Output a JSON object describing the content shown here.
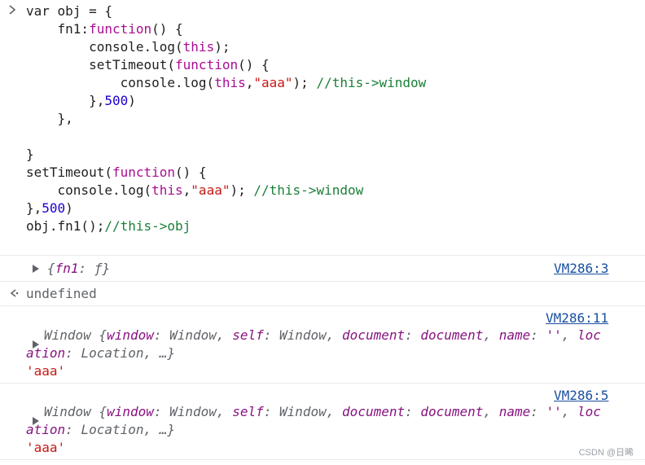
{
  "input": {
    "line_1": {
      "a": "var obj = {"
    },
    "line_2": {
      "a": "    fn1:",
      "b": "function",
      "c": "() {"
    },
    "line_3": {
      "a": "        console.log(",
      "b": "this",
      "c": ");"
    },
    "line_4": {
      "a": "        setTimeout(",
      "b": "function",
      "c": "() {"
    },
    "line_5": {
      "a": "            console.log(",
      "b": "this",
      "c": ",",
      "d": "\"aaa\"",
      "e": "); ",
      "f": "//this->window"
    },
    "line_6": {
      "a": "        },",
      "b": "500",
      "c": ")"
    },
    "line_7": {
      "a": "    },"
    },
    "line_8": {
      "a": ""
    },
    "line_9": {
      "a": "}"
    },
    "line_10": {
      "a": "setTimeout(",
      "b": "function",
      "c": "() {"
    },
    "line_11": {
      "a": "    console.log(",
      "b": "this",
      "c": ",",
      "d": "\"aaa\"",
      "e": "); ",
      "f": "//this->window"
    },
    "line_12": {
      "a": "},",
      "b": "500",
      "c": ")"
    },
    "line_13": {
      "a": "obj.fn1();",
      "b": "//this->obj"
    }
  },
  "output_1": {
    "text_open": "{",
    "key": "fn1",
    "sep": ": ",
    "value": "ƒ",
    "text_close": "}",
    "source_link": "VM286:3"
  },
  "return_value": {
    "text": "undefined"
  },
  "output_2": {
    "source_link": "VM286:11",
    "line1": {
      "t0": "Window {",
      "k1": "window",
      "s1": ": ",
      "v1": "Window",
      "c1": ", ",
      "k2": "self",
      "s2": ": ",
      "v2": "Window",
      "c2": ", ",
      "k3": "document",
      "s3": ": ",
      "v3": "document",
      "c3": ", ",
      "k4": "name",
      "s4": ": ",
      "v4": "''",
      "c4": ", ",
      "k5a": "loc"
    },
    "line2": {
      "k5b": "ation",
      "s5": ": ",
      "v5": "Location",
      "tail": ", …}"
    },
    "string": "'aaa'"
  },
  "output_3": {
    "source_link": "VM286:5",
    "line1": {
      "t0": "Window {",
      "k1": "window",
      "s1": ": ",
      "v1": "Window",
      "c1": ", ",
      "k2": "self",
      "s2": ": ",
      "v2": "Window",
      "c2": ", ",
      "k3": "document",
      "s3": ": ",
      "v3": "document",
      "c3": ", ",
      "k4": "name",
      "s4": ": ",
      "v4": "''",
      "c4": ", ",
      "k5a": "loc"
    },
    "line2": {
      "k5b": "ation",
      "s5": ": ",
      "v5": "Location",
      "tail": ", …}"
    },
    "string": "'aaa'"
  },
  "watermark": "CSDN @日晞",
  "colors": {
    "keyword": "#aa0d91",
    "string": "#c41a16",
    "number": "#1c00cf",
    "comment": "#1a7f37",
    "link": "#1a4fa0"
  }
}
